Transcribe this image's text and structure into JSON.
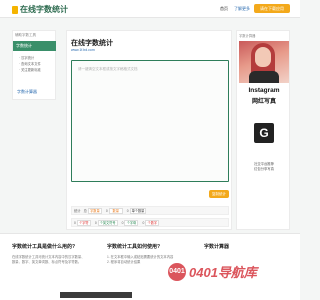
{
  "header": {
    "logo_text": "在线字数统计",
    "nav_home": "首页",
    "nav_about": "了解更多",
    "nav_pill": "请在下载应用"
  },
  "sidebar": {
    "title": "辅助字数工具",
    "active": "字数统计",
    "items": [
      "·  汉字统计",
      "·  查询文本文件",
      "·  关注更新标准"
    ],
    "link": "字数计算器"
  },
  "main": {
    "title": "在线字数统计",
    "url": "www.1f.bd.com",
    "textarea_placeholder": "请一键清空文本框或按文字稿格式文档",
    "copy_button": "复制统计"
  },
  "stats": {
    "total_label": "统计",
    "row1": [
      {
        "label": "总",
        "value": "字数量",
        "tone": "orange"
      },
      {
        "label": "0",
        "value": "数量",
        "tone": "orange"
      },
      {
        "label": "0",
        "value": "单个数量",
        "tone": "plain"
      }
    ],
    "row2": [
      {
        "label": "0",
        "value": "个字符",
        "tone": "red"
      },
      {
        "label": "0",
        "value": "个英文符号",
        "tone": "green"
      },
      {
        "label": "0",
        "value": "个字母",
        "tone": "green"
      },
      {
        "label": "0",
        "value": "个数字",
        "tone": "red"
      }
    ]
  },
  "tip": {
    "prefix": "字数计算器",
    "highlight": "使用说明",
    "suffix": "，让您写作更好。"
  },
  "ad": {
    "title": "字数计算器",
    "insta1": "Instagram",
    "insta2": "网红写真",
    "g_letter": "G",
    "text1": "社交平台推荐",
    "text2": "红包分享写真"
  },
  "bottom": {
    "col1_heading": "字数统计工具是做什么用的?",
    "col1_lines": [
      "在线字数统计工具可统计文本内容中的汉字数量、",
      "数量、数字、英文单词数、标点符号及字符数。"
    ],
    "col2_heading": "字数统计工具如何使用?",
    "col2_lines": [
      "1. 在文本框中输入或粘贴需要统计的文本内容",
      "2. 程序将自动统计结果"
    ],
    "col3_heading": "字数计算器"
  },
  "watermark": {
    "circle": "0401",
    "text": "0401导航库"
  },
  "colors": {
    "accent_green": "#3a8f6a",
    "accent_orange": "#f3a91b",
    "link_blue": "#2b6cb0"
  }
}
